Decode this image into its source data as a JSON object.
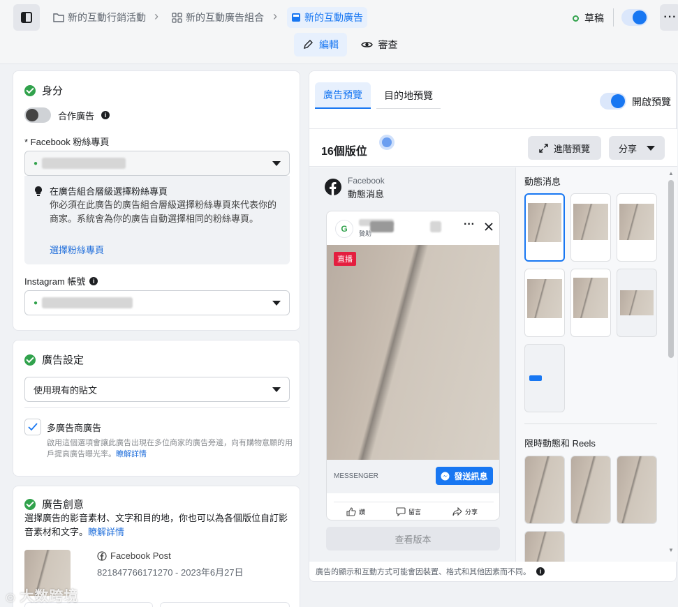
{
  "breadcrumb": {
    "campaign": "新的互動行銷活動",
    "adset": "新的互動廣告組合",
    "ad": "新的互動廣告"
  },
  "status": {
    "label": "草稿"
  },
  "tabs": {
    "edit": "編輯",
    "review": "審查"
  },
  "identity": {
    "title": "身分",
    "partnership_label": "合作廣告",
    "fb_page_label": "* Facebook 粉絲專頁",
    "tip_title": "在廣告組合層級選擇粉絲專頁",
    "tip_body": "你必須在此廣告的廣告組合層級選擇粉絲專頁來代表你的商家。系統會為你的廣告自動選擇相同的粉絲專頁。",
    "tip_link": "選擇粉絲專頁",
    "ig_label": "Instagram 帳號"
  },
  "ad_setup": {
    "title": "廣告設定",
    "select_value": "使用現有的貼文",
    "multi_label": "多廣告商廣告",
    "multi_desc": "啟用這個選項會讓此廣告出現在多位商家的廣告旁邊，向有購物意願的用戶提高廣告曝光率。",
    "multi_link": "瞭解詳情"
  },
  "creative": {
    "title": "廣告創意",
    "desc": "選擇廣告的影音素材、文字和目的地，你也可以為各個版位自訂影音素材和文字。",
    "desc_link": "瞭解詳情",
    "post_source": "Facebook Post",
    "post_meta": "821847766171270 - 2023年6月27日"
  },
  "preview": {
    "tab_ad": "廣告預覽",
    "tab_dest": "目的地預覽",
    "toggle_label": "開啟預覽",
    "placements": "16個版位",
    "advanced_btn": "進階預覽",
    "share_btn": "分享",
    "platform": "Facebook",
    "placement_name": "動態消息",
    "sponsored": "贊助",
    "live_badge": "直播",
    "cta_source": "MESSENGER",
    "cta_btn": "發送訊息",
    "action_like": "讚",
    "action_comment": "留言",
    "action_share": "分享",
    "view_version": "查看版本",
    "group_feed": "動態消息",
    "group_stories": "限時動態和 Reels",
    "disclaimer": "廣告的顯示和互動方式可能會因裝置、格式和其他因素而不同。"
  },
  "watermark": "大数跨境",
  "colors": {
    "accent": "#1877f2",
    "success": "#31a24c",
    "live": "#e41e3f"
  }
}
